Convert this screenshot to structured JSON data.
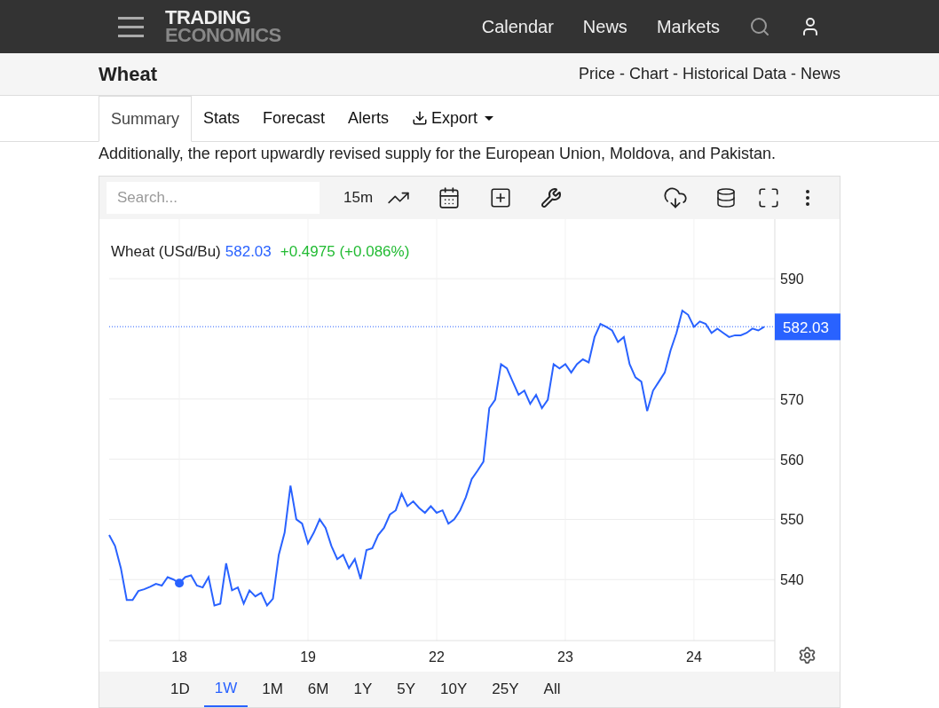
{
  "header": {
    "logo": [
      "TRADING",
      "ECONOMICS"
    ],
    "nav": [
      "Calendar",
      "News",
      "Markets"
    ]
  },
  "title_bar": {
    "title": "Wheat",
    "separator": "-",
    "links": [
      "Price",
      "Chart",
      "Historical Data",
      "News"
    ]
  },
  "tabs": [
    {
      "label": "Summary",
      "selected": true,
      "kind": "tab"
    },
    {
      "label": "Stats",
      "selected": false,
      "kind": "tab"
    },
    {
      "label": "Forecast",
      "selected": false,
      "kind": "tab"
    },
    {
      "label": "Alerts",
      "selected": false,
      "kind": "tab"
    },
    {
      "label": "Export",
      "selected": false,
      "kind": "menu"
    }
  ],
  "paragraph": "Additionally, the report upwardly revised supply for the European Union, Moldova, and Pakistan.",
  "chart": {
    "search_placeholder": "Search...",
    "interval": "15m",
    "legend": {
      "symbol": "Wheat (USd/Bu)",
      "price": "582.03",
      "change": "+0.4975 (+0.086%)"
    },
    "price_tag": "582.03",
    "chart_data": {
      "type": "line",
      "ylim": [
        524.7,
        599.9
      ],
      "grid": true,
      "ref_lines": [
        {
          "axis": "y",
          "value": 582.03,
          "color": "#2962ff"
        }
      ],
      "categories": [
        null,
        null,
        null,
        null,
        null,
        null,
        null,
        null,
        null,
        null,
        null,
        null,
        "18",
        null,
        null,
        null,
        null,
        null,
        null,
        null,
        null,
        null,
        null,
        null,
        null,
        null,
        null,
        null,
        null,
        null,
        null,
        null,
        null,
        null,
        "19",
        null,
        null,
        null,
        null,
        null,
        null,
        null,
        null,
        null,
        null,
        null,
        null,
        null,
        null,
        null,
        null,
        null,
        null,
        null,
        null,
        null,
        "22",
        null,
        null,
        null,
        null,
        null,
        null,
        null,
        null,
        null,
        null,
        null,
        null,
        null,
        null,
        null,
        null,
        null,
        null,
        null,
        null,
        null,
        "23",
        null,
        null,
        null,
        null,
        null,
        null,
        null,
        null,
        null,
        null,
        null,
        null,
        null,
        null,
        null,
        null,
        null,
        null,
        null,
        null,
        null,
        "24",
        null,
        null,
        null,
        null,
        null,
        null,
        null,
        null,
        null,
        null,
        null,
        null
      ],
      "yticks": [
        540,
        550,
        560,
        570,
        590
      ],
      "series": [
        {
          "color": "#2962ff",
          "values": [
            547.4,
            545.6,
            541.9,
            536.6,
            536.6,
            538.1,
            538.4,
            538.8,
            539.3,
            539.0,
            540.4,
            540.0,
            539.4,
            540.4,
            540.7,
            539.0,
            538.7,
            540.4,
            535.7,
            536.0,
            542.7,
            538.2,
            538.7,
            536.0,
            538.2,
            537.2,
            537.8,
            535.7,
            536.8,
            544.1,
            547.8,
            555.6,
            550.0,
            549.3,
            546.0,
            547.8,
            550.0,
            548.6,
            545.6,
            543.4,
            544.1,
            541.9,
            543.4,
            540.1,
            544.9,
            545.2,
            547.4,
            548.6,
            550.8,
            551.5,
            554.3,
            552.2,
            553.0,
            551.9,
            551.1,
            552.2,
            551.1,
            551.5,
            549.3,
            550.0,
            551.5,
            553.7,
            556.7,
            558.1,
            559.6,
            568.5,
            569.9,
            575.8,
            575.1,
            572.9,
            570.7,
            571.4,
            569.2,
            570.7,
            568.5,
            569.9,
            575.8,
            575.1,
            575.8,
            574.4,
            575.8,
            576.6,
            576.1,
            580.3,
            582.5,
            582.0,
            581.4,
            579.5,
            580.3,
            575.8,
            573.6,
            572.9,
            568.0,
            571.4,
            572.9,
            574.4,
            578.1,
            581.0,
            584.7,
            584.0,
            582.0,
            582.9,
            582.5,
            581.0,
            581.7,
            581.0,
            580.3,
            580.6,
            580.6,
            581.0,
            581.7,
            581.4,
            582.0
          ]
        }
      ]
    },
    "ranges": [
      {
        "label": "1D",
        "selected": false
      },
      {
        "label": "1W",
        "selected": true
      },
      {
        "label": "1M",
        "selected": false
      },
      {
        "label": "6M",
        "selected": false
      },
      {
        "label": "1Y",
        "selected": false
      },
      {
        "label": "5Y",
        "selected": false
      },
      {
        "label": "10Y",
        "selected": false
      },
      {
        "label": "25Y",
        "selected": false
      },
      {
        "label": "All",
        "selected": false
      }
    ]
  }
}
